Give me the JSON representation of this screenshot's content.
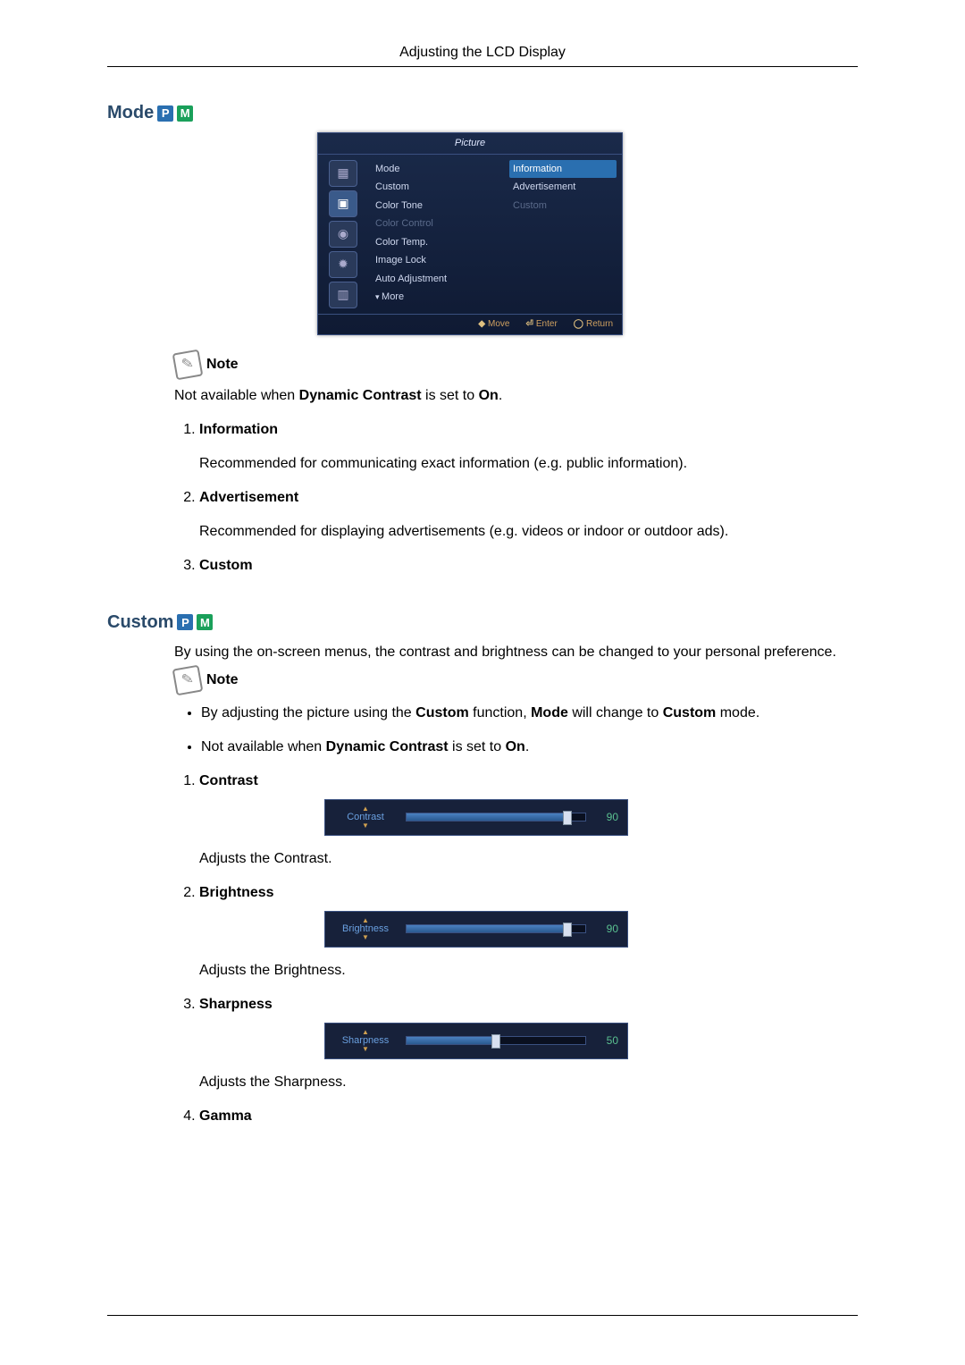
{
  "header": {
    "title": "Adjusting the LCD Display"
  },
  "badges": {
    "p": "P",
    "m": "M"
  },
  "mode": {
    "heading": "Mode",
    "osd": {
      "title": "Picture",
      "left_items": [
        {
          "label": "Mode",
          "dim": false
        },
        {
          "label": "Custom",
          "dim": false
        },
        {
          "label": "Color Tone",
          "dim": false
        },
        {
          "label": "Color Control",
          "dim": true
        },
        {
          "label": "Color Temp.",
          "dim": false
        },
        {
          "label": "Image Lock",
          "dim": false
        },
        {
          "label": "Auto Adjustment",
          "dim": false
        },
        {
          "label": "More",
          "dim": false,
          "more": true
        }
      ],
      "right_items": [
        {
          "label": "Information",
          "sel": true
        },
        {
          "label": "Advertisement",
          "sel": false
        },
        {
          "label": "Custom",
          "sel": false,
          "dim": true
        }
      ],
      "footer": {
        "move": "Move",
        "enter": "Enter",
        "return": "Return"
      }
    },
    "note_label": "Note",
    "note_text_pre": "Not available when ",
    "note_text_b1": "Dynamic Contrast",
    "note_text_mid": " is set to ",
    "note_text_b2": "On",
    "list": [
      {
        "title": "Information",
        "desc": "Recommended for communicating exact information (e.g. public information)."
      },
      {
        "title": "Advertisement",
        "desc": "Recommended for displaying advertisements (e.g. videos or indoor or outdoor ads)."
      },
      {
        "title": "Custom",
        "desc": ""
      }
    ]
  },
  "custom": {
    "heading": "Custom",
    "intro": "By using the on-screen menus, the contrast and brightness can be changed to your personal preference.",
    "note_label": "Note",
    "bullets": [
      {
        "pre": "By adjusting the picture using the ",
        "b1": "Custom",
        "mid1": " function, ",
        "b2": "Mode",
        "mid2": " will change to ",
        "b3": "Custom",
        "post": " mode."
      },
      {
        "pre": "Not available when ",
        "b1": "Dynamic Contrast",
        "mid1": " is set to ",
        "b2": "On",
        "mid2": "",
        "b3": "",
        "post": "."
      }
    ],
    "list": [
      {
        "title": "Contrast",
        "slider_label": "Contrast",
        "value": 90,
        "desc": "Adjusts the Contrast."
      },
      {
        "title": "Brightness",
        "slider_label": "Brightness",
        "value": 90,
        "desc": "Adjusts the Brightness."
      },
      {
        "title": "Sharpness",
        "slider_label": "Sharpness",
        "value": 50,
        "desc": "Adjusts the Sharpness."
      },
      {
        "title": "Gamma",
        "slider_label": "",
        "value": null,
        "desc": ""
      }
    ]
  }
}
